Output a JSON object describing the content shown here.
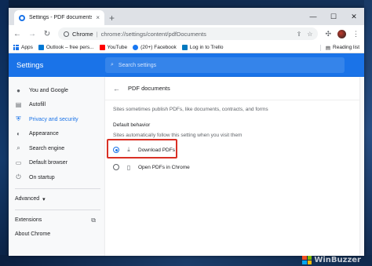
{
  "tab": {
    "title": "Settings - PDF documents",
    "close": "×"
  },
  "newtab": "+",
  "window_controls": {
    "minimize": "—",
    "maximize": "☐",
    "close": "✕"
  },
  "toolbar": {
    "back": "←",
    "forward": "→",
    "reload": "↻",
    "omnibox_host": "Chrome",
    "omnibox_path": "chrome://settings/content/pdfDocuments"
  },
  "bookmarks": {
    "items": [
      {
        "label": "Apps",
        "color": "#1a73e8"
      },
      {
        "label": "Outlook – free pers...",
        "color": "#0078d4"
      },
      {
        "label": "YouTube",
        "color": "#ff0000"
      },
      {
        "label": "(20+) Facebook",
        "color": "#1877f2"
      },
      {
        "label": "Log in to Trello",
        "color": "#0079bf"
      }
    ],
    "reading_list": "Reading list"
  },
  "settings": {
    "title": "Settings",
    "search_placeholder": "Search settings"
  },
  "sidebar": {
    "items": [
      {
        "label": "You and Google",
        "icon": "person-icon",
        "glyph": "👤",
        "active": false
      },
      {
        "label": "Autofill",
        "icon": "clipboard-icon",
        "glyph": "▤",
        "active": false
      },
      {
        "label": "Privacy and security",
        "icon": "shield-icon",
        "glyph": "⛨",
        "active": true
      },
      {
        "label": "Appearance",
        "icon": "palette-icon",
        "glyph": "◐",
        "active": false
      },
      {
        "label": "Search engine",
        "icon": "search-icon",
        "glyph": "⌕",
        "active": false
      },
      {
        "label": "Default browser",
        "icon": "browser-icon",
        "glyph": "▭",
        "active": false
      },
      {
        "label": "On startup",
        "icon": "power-icon",
        "glyph": "⏻",
        "active": false
      }
    ],
    "advanced": "Advanced",
    "advanced_chevron": "▾",
    "extensions": "Extensions",
    "extensions_link": "⧉",
    "about": "About Chrome"
  },
  "page": {
    "back": "←",
    "title": "PDF documents",
    "description": "Sites sometimes publish PDFs, like documents, contracts, and forms",
    "section_title": "Default behavior",
    "section_subtitle": "Sites automatically follow this setting when you visit them",
    "options": [
      {
        "label": "Download PDFs",
        "icon": "download-icon",
        "glyph": "⤓",
        "selected": true
      },
      {
        "label": "Open PDFs in Chrome",
        "icon": "document-icon",
        "glyph": "▯",
        "selected": false
      }
    ],
    "highlight_color": "#d93025"
  },
  "colors": {
    "accent": "#1a73e8",
    "header": "#1a73e8"
  },
  "watermark": "WinBuzzer"
}
